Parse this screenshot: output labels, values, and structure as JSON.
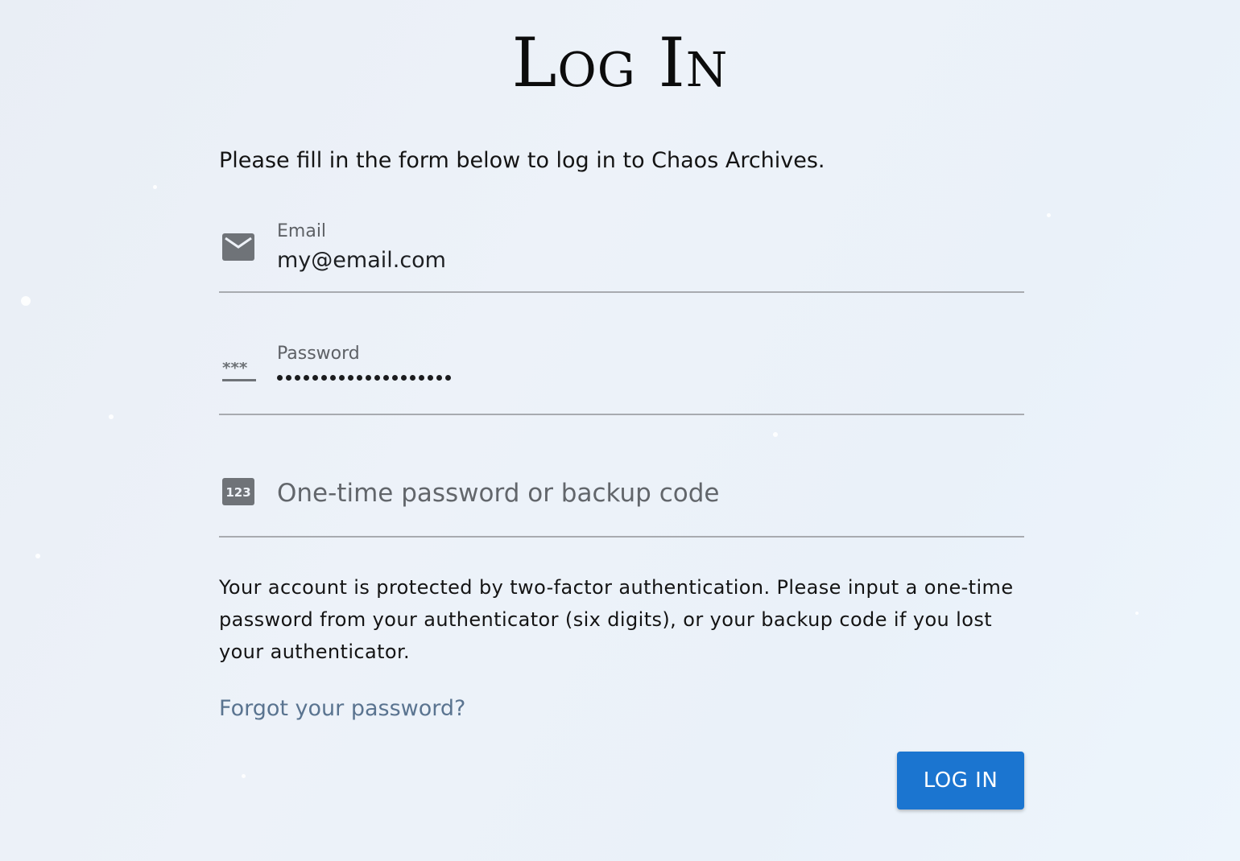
{
  "page": {
    "title": "Log In",
    "intro": "Please fill in the form below to log in to Chaos Archives."
  },
  "form": {
    "email": {
      "label": "Email",
      "value": "my@email.com",
      "icon": "mail-icon"
    },
    "password": {
      "label": "Password",
      "masked_length": 20,
      "icon": "password-icon"
    },
    "otp": {
      "placeholder": "One-time password or backup code",
      "icon_text": "123",
      "icon": "numeric-pad-icon"
    },
    "two_factor_note": "Your account is protected by two-factor authentication. Please input a one-time password from your authenticator (six digits), or your backup code if you lost your authenticator.",
    "forgot_link": "Forgot your password?",
    "submit_label": "LOG IN"
  },
  "colors": {
    "primary_button": "#1b75d0",
    "link": "#5a7490",
    "icon": "#6f7378",
    "underline": "#a8abb0"
  }
}
